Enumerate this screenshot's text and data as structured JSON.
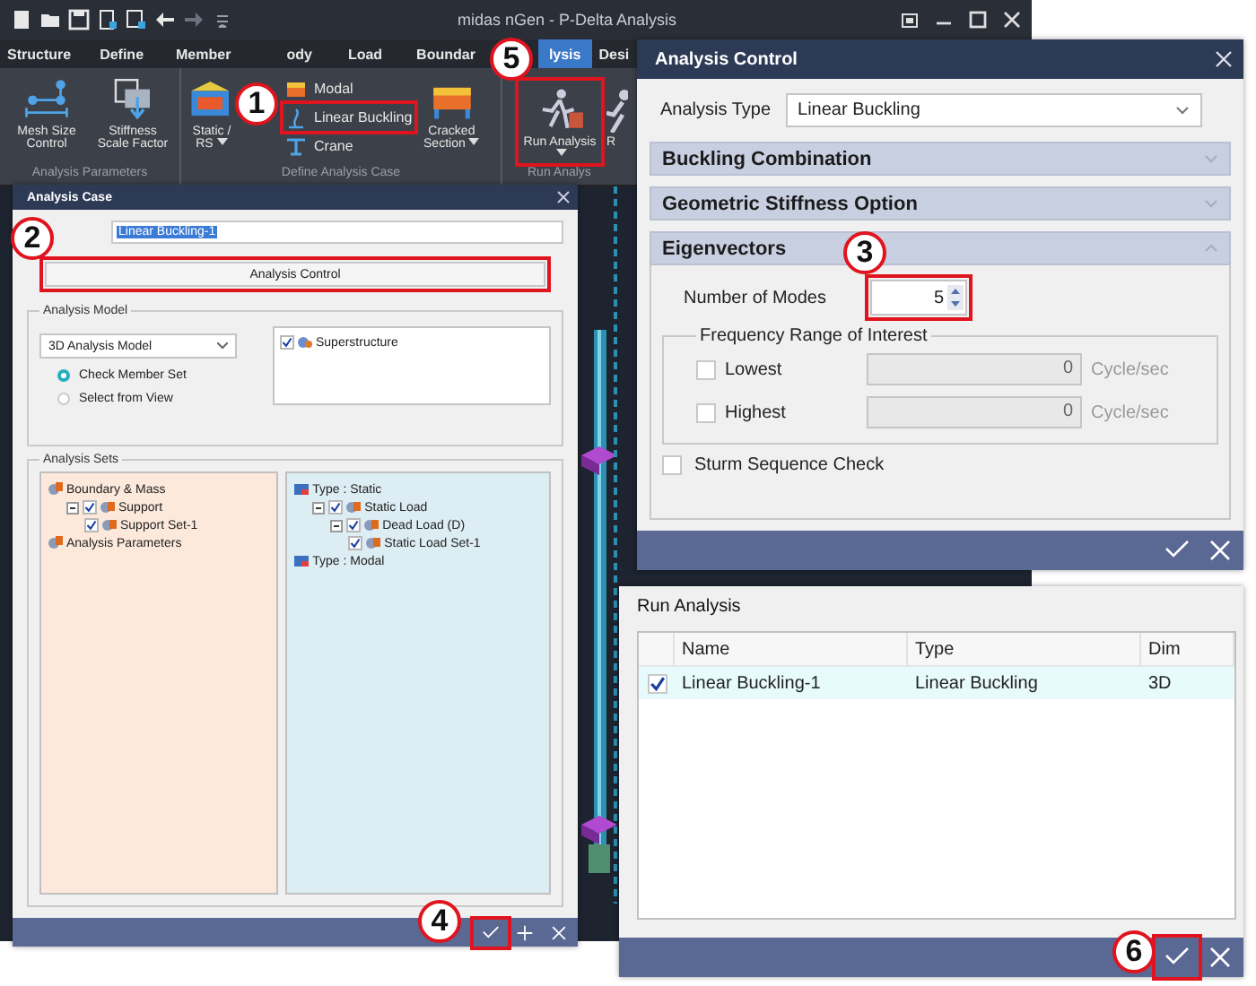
{
  "app": {
    "title": "midas nGen - P-Delta Analysis",
    "menu_tabs": [
      {
        "label": "Structure",
        "selected": false
      },
      {
        "label": "Define",
        "selected": false
      },
      {
        "label": "Member",
        "selected": false
      },
      {
        "label": "ody",
        "selected": false
      },
      {
        "label": "Load",
        "selected": false
      },
      {
        "label": "Boundar",
        "selected": false
      },
      {
        "label": "lysis",
        "selected": true
      },
      {
        "label": "Desi",
        "selected": false
      }
    ],
    "ribbon_groups": [
      {
        "label": "Analysis Parameters",
        "items": [
          {
            "kind": "large",
            "label": "Mesh Size Control",
            "dropdown": false
          },
          {
            "kind": "large",
            "label": "Stiffness Scale Factor",
            "dropdown": false
          }
        ]
      },
      {
        "label": "Define Analysis Case",
        "items": [
          {
            "kind": "large",
            "label": "Static / RS",
            "dropdown": true
          },
          {
            "kind": "stack",
            "entries": [
              {
                "label": "Modal"
              },
              {
                "label": "Linear Buckling"
              },
              {
                "label": "Crane"
              }
            ]
          },
          {
            "kind": "large",
            "label": "Cracked Section",
            "dropdown": true
          }
        ]
      },
      {
        "label": "Run Analys",
        "items": [
          {
            "kind": "large",
            "label": "Run Analysis",
            "dropdown": true
          },
          {
            "kind": "partial",
            "label": "R"
          }
        ]
      }
    ]
  },
  "analysis_case": {
    "title": "Analysis Case",
    "name_value": "Linear Buckling-1",
    "control_button": "Analysis Control",
    "model_group": {
      "legend": "Analysis Model",
      "select": "3D Analysis Model",
      "radios": [
        {
          "label": "Check Member Set",
          "selected": true
        },
        {
          "label": "Select from View",
          "selected": false
        }
      ],
      "list": [
        {
          "label": "Superstructure",
          "checked": true
        }
      ]
    },
    "sets_group": {
      "legend": "Analysis Sets",
      "left_tree": [
        {
          "kind": "group",
          "label": "Boundary & Mass",
          "children": [
            {
              "kind": "item",
              "label": "Support",
              "checked": true,
              "expanded": true,
              "children": [
                {
                  "kind": "item",
                  "label": "Support Set-1",
                  "checked": true
                }
              ]
            }
          ]
        },
        {
          "kind": "group",
          "label": "Analysis Parameters"
        }
      ],
      "right_tree": [
        {
          "kind": "type",
          "label": "Type : Static",
          "children": [
            {
              "kind": "item",
              "label": "Static Load",
              "checked": true,
              "expanded": true,
              "children": [
                {
                  "kind": "item",
                  "label": "Dead Load (D)",
                  "checked": true,
                  "expanded": true,
                  "children": [
                    {
                      "kind": "item",
                      "label": "Static Load Set-1",
                      "checked": true
                    }
                  ]
                }
              ]
            }
          ]
        },
        {
          "kind": "type",
          "label": "Type : Modal"
        }
      ]
    }
  },
  "analysis_control": {
    "title": "Analysis Control",
    "type_label": "Analysis Type",
    "type_value": "Linear Buckling",
    "sections": [
      {
        "label": "Buckling Combination",
        "expanded": false
      },
      {
        "label": "Geometric Stiffness Option",
        "expanded": false
      },
      {
        "label": "Eigenvectors",
        "expanded": true
      }
    ],
    "modes_label": "Number of Modes",
    "modes_value": "5",
    "frequency": {
      "legend": "Frequency Range of Interest",
      "rows": [
        {
          "label": "Lowest",
          "checked": false,
          "value": "0",
          "unit": "Cycle/sec"
        },
        {
          "label": "Highest",
          "checked": false,
          "value": "0",
          "unit": "Cycle/sec"
        }
      ]
    },
    "sturm": {
      "label": "Sturm Sequence Check",
      "checked": false
    }
  },
  "run_analysis": {
    "title": "Run Analysis",
    "columns": [
      "Name",
      "Type",
      "Dim"
    ],
    "rows": [
      {
        "checked": true,
        "cells": [
          "Linear Buckling-1",
          "Linear Buckling",
          "3D"
        ]
      }
    ]
  },
  "callouts": [
    {
      "number": "1"
    },
    {
      "number": "2"
    },
    {
      "number": "3"
    },
    {
      "number": "4"
    },
    {
      "number": "5"
    },
    {
      "number": "6"
    }
  ]
}
